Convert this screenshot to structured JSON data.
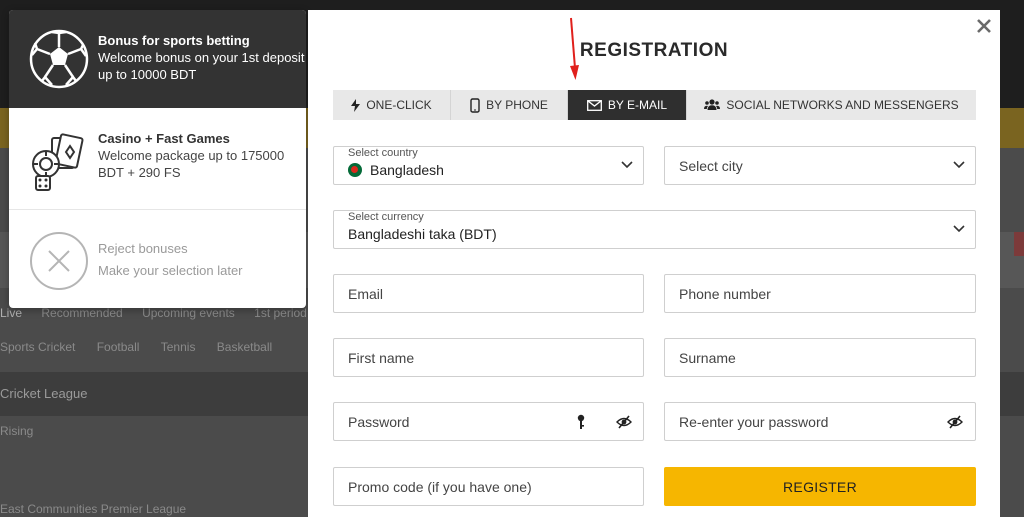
{
  "background": {
    "nav": [
      "Live",
      "Recommended",
      "Upcoming events",
      "1st period"
    ],
    "sports": [
      "Sports Cricket",
      "Football",
      "Tennis",
      "Basketball"
    ],
    "league": "Cricket League",
    "row1": "Rising",
    "row2": "East Communities Premier League"
  },
  "bonus": {
    "items": [
      {
        "title": "Bonus for sports betting",
        "desc": "Welcome bonus on your 1st deposit up to 10000 BDT",
        "icon": "soccer-ball-icon",
        "selected": true
      },
      {
        "title": "Casino + Fast Games",
        "desc": "Welcome package up to 175000 BDT + 290 FS",
        "icon": "casino-chips-cards-icon",
        "selected": false
      },
      {
        "title": "Reject bonuses",
        "desc": "Make your selection later",
        "icon": "reject-x-icon",
        "selected": false
      }
    ]
  },
  "modal": {
    "title": "REGISTRATION",
    "close_icon": "close-icon",
    "tabs": [
      {
        "label": "ONE-CLICK",
        "icon": "lightning-icon",
        "active": false
      },
      {
        "label": "BY PHONE",
        "icon": "phone-icon",
        "active": false
      },
      {
        "label": "BY E-MAIL",
        "icon": "envelope-icon",
        "active": true
      },
      {
        "label": "SOCIAL NETWORKS AND MESSENGERS",
        "icon": "users-icon",
        "active": false
      }
    ],
    "country": {
      "label": "Select country",
      "value": "Bangladesh"
    },
    "city": {
      "placeholder": "Select city"
    },
    "currency": {
      "label": "Select currency",
      "value": "Bangladeshi taka (BDT)"
    },
    "email": {
      "placeholder": "Email"
    },
    "phone": {
      "placeholder": "Phone number"
    },
    "first_name": {
      "placeholder": "First name"
    },
    "surname": {
      "placeholder": "Surname"
    },
    "password": {
      "placeholder": "Password"
    },
    "reenter_password": {
      "placeholder": "Re-enter your password"
    },
    "promo": {
      "placeholder": "Promo code (if you have one)"
    },
    "register_label": "REGISTER"
  },
  "colors": {
    "accent": "#f6b600",
    "active_tab": "#2f2f2f",
    "selected_bonus": "#333333",
    "annotation_arrow": "#e0201c"
  }
}
